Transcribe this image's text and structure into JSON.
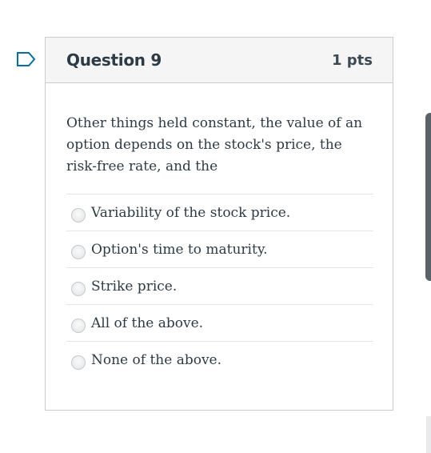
{
  "question": {
    "title": "Question 9",
    "points": "1 pts",
    "text": "Other things held constant, the value of an option depends on the stock's price, the risk-free rate, and the",
    "answers": [
      {
        "label": "Variability of the stock price."
      },
      {
        "label": "Option's time to maturity."
      },
      {
        "label": "Strike price."
      },
      {
        "label": "All of the above."
      },
      {
        "label": "None of the above."
      }
    ]
  },
  "icons": {
    "flag": "flag-icon"
  },
  "colors": {
    "accent": "#0770a3",
    "text": "#2d3b45",
    "border": "#c7cdd1",
    "header_bg": "#f5f5f5"
  }
}
